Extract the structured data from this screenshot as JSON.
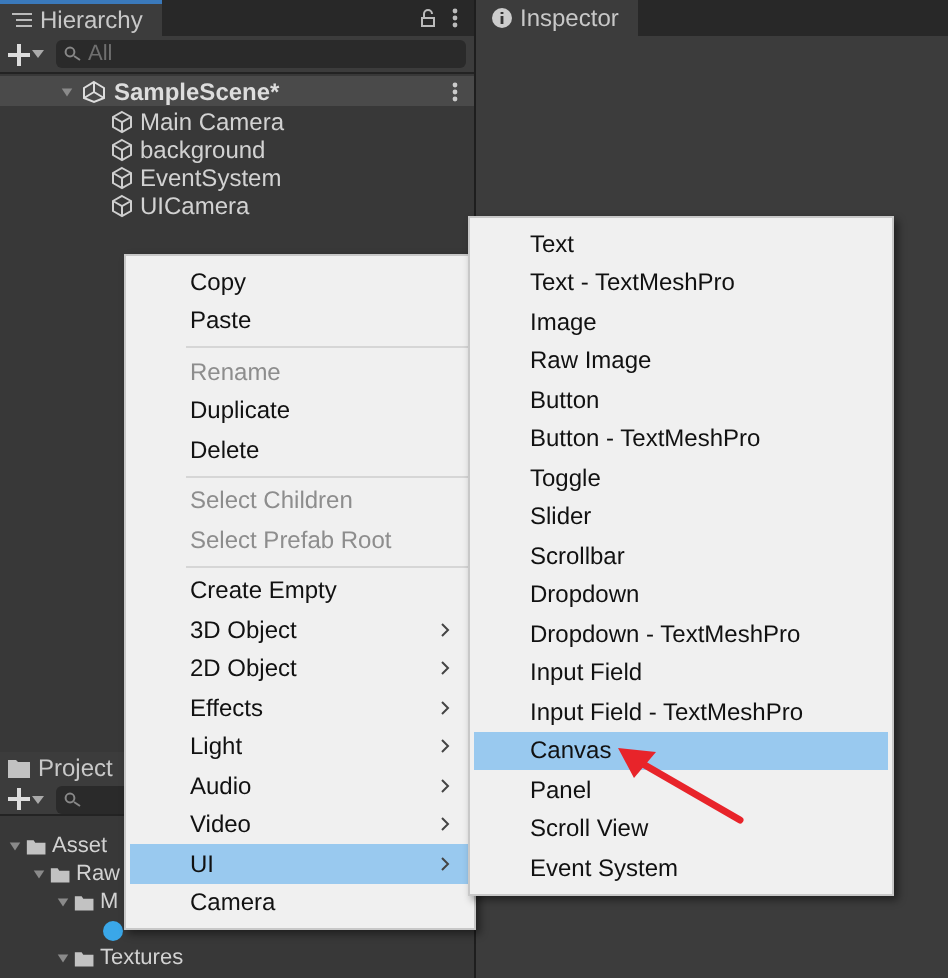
{
  "hierarchy": {
    "tab": "Hierarchy",
    "search_placeholder": "All",
    "scene": {
      "name": "SampleScene*",
      "expanded": true
    },
    "items": [
      {
        "label": "Main Camera"
      },
      {
        "label": "background"
      },
      {
        "label": "EventSystem"
      },
      {
        "label": "UICamera"
      }
    ]
  },
  "inspector": {
    "tab": "Inspector"
  },
  "project": {
    "tab": "Project",
    "tree": [
      {
        "label": "Asset",
        "expanded": true,
        "children": [
          {
            "label": "Raw",
            "expanded": true,
            "children": [
              {
                "label": "M",
                "expanded": true,
                "children": [
                  {
                    "kind": "material"
                  }
                ]
              },
              {
                "label": "Textures",
                "expanded": true
              }
            ]
          }
        ]
      }
    ]
  },
  "context_menu": [
    {
      "kind": "item",
      "label": "Copy",
      "disabled": false,
      "submenu": false,
      "selected": false
    },
    {
      "kind": "item",
      "label": "Paste",
      "disabled": false,
      "submenu": false,
      "selected": false
    },
    {
      "kind": "separator"
    },
    {
      "kind": "item",
      "label": "Rename",
      "disabled": true,
      "submenu": false,
      "selected": false
    },
    {
      "kind": "item",
      "label": "Duplicate",
      "disabled": false,
      "submenu": false,
      "selected": false
    },
    {
      "kind": "item",
      "label": "Delete",
      "disabled": false,
      "submenu": false,
      "selected": false
    },
    {
      "kind": "separator"
    },
    {
      "kind": "item",
      "label": "Select Children",
      "disabled": true,
      "submenu": false,
      "selected": false
    },
    {
      "kind": "item",
      "label": "Select Prefab Root",
      "disabled": true,
      "submenu": false,
      "selected": false
    },
    {
      "kind": "separator"
    },
    {
      "kind": "item",
      "label": "Create Empty",
      "disabled": false,
      "submenu": false,
      "selected": false
    },
    {
      "kind": "item",
      "label": "3D Object",
      "disabled": false,
      "submenu": true,
      "selected": false
    },
    {
      "kind": "item",
      "label": "2D Object",
      "disabled": false,
      "submenu": true,
      "selected": false
    },
    {
      "kind": "item",
      "label": "Effects",
      "disabled": false,
      "submenu": true,
      "selected": false
    },
    {
      "kind": "item",
      "label": "Light",
      "disabled": false,
      "submenu": true,
      "selected": false
    },
    {
      "kind": "item",
      "label": "Audio",
      "disabled": false,
      "submenu": true,
      "selected": false
    },
    {
      "kind": "item",
      "label": "Video",
      "disabled": false,
      "submenu": true,
      "selected": false
    },
    {
      "kind": "item",
      "label": "UI",
      "disabled": false,
      "submenu": true,
      "selected": true
    },
    {
      "kind": "item",
      "label": "Camera",
      "disabled": false,
      "submenu": false,
      "selected": false
    }
  ],
  "ui_submenu": [
    {
      "label": "Text",
      "selected": false
    },
    {
      "label": "Text - TextMeshPro",
      "selected": false
    },
    {
      "label": "Image",
      "selected": false
    },
    {
      "label": "Raw Image",
      "selected": false
    },
    {
      "label": "Button",
      "selected": false
    },
    {
      "label": "Button - TextMeshPro",
      "selected": false
    },
    {
      "label": "Toggle",
      "selected": false
    },
    {
      "label": "Slider",
      "selected": false
    },
    {
      "label": "Scrollbar",
      "selected": false
    },
    {
      "label": "Dropdown",
      "selected": false
    },
    {
      "label": "Dropdown - TextMeshPro",
      "selected": false
    },
    {
      "label": "Input Field",
      "selected": false
    },
    {
      "label": "Input Field - TextMeshPro",
      "selected": false
    },
    {
      "label": "Canvas",
      "selected": true
    },
    {
      "label": "Panel",
      "selected": false
    },
    {
      "label": "Scroll View",
      "selected": false
    },
    {
      "label": "Event System",
      "selected": false
    }
  ]
}
